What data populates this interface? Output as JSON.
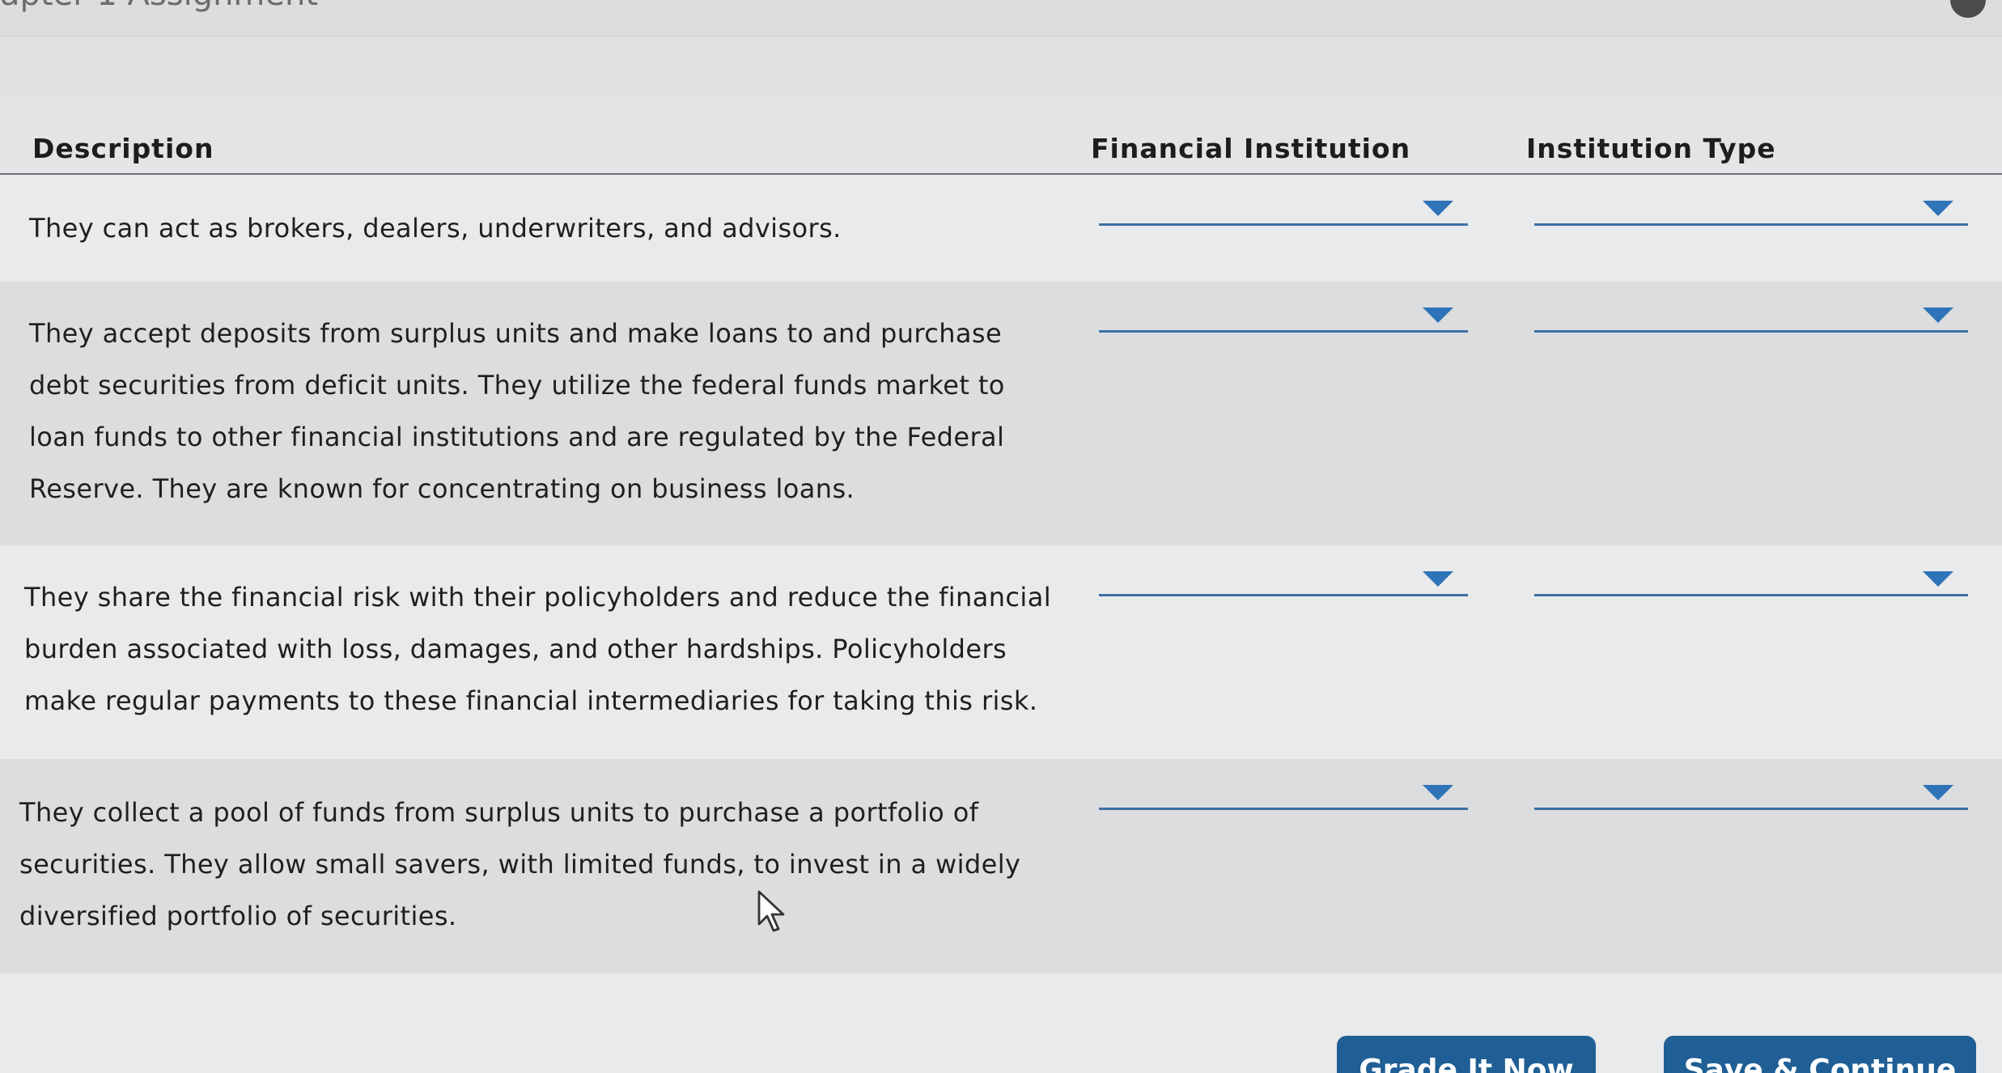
{
  "header": {
    "title": "apter 1 Assignment"
  },
  "table": {
    "columns": {
      "description": "Description",
      "institution": "Financial Institution",
      "type": "Institution Type"
    },
    "rows": [
      {
        "description": "They can act as brokers, dealers, underwriters, and advisors.",
        "institution": "",
        "type": ""
      },
      {
        "description": "They accept deposits from surplus units and make loans to and purchase debt securities from deficit units. They utilize the federal funds market to loan funds to other financial institutions and are regulated by the Federal Reserve. They are known for concentrating on business loans.",
        "institution": "",
        "type": ""
      },
      {
        "description": "They share the financial risk with their policyholders and reduce the financial burden associated with loss, damages, and other hardships. Policyholders make regular payments to these financial intermediaries for taking this risk.",
        "institution": "",
        "type": ""
      },
      {
        "description": "They collect a pool of funds from surplus units to purchase a portfolio of securities. They allow small savers, with limited funds, to invest in a widely diversified portfolio of securities.",
        "institution": "",
        "type": ""
      }
    ]
  },
  "actions": {
    "grade_label": "Grade It Now",
    "save_label": "Save & Continue"
  },
  "colors": {
    "accent": "#2f73b8",
    "button": "#1f5f95",
    "underline": "#3d6fa3"
  },
  "icons": {
    "dropdown": "caret-down-icon",
    "cursor": "mouse-pointer-icon"
  }
}
